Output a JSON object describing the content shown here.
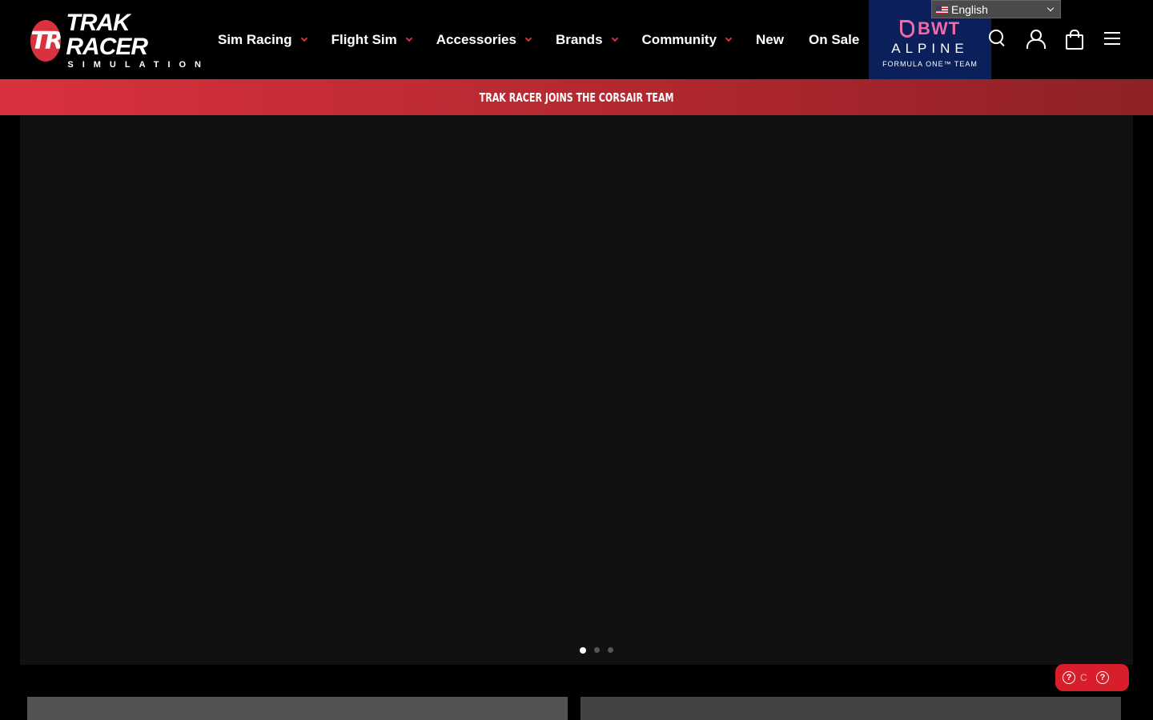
{
  "brand": {
    "badge": "TR",
    "name": "TRAK RACER",
    "tagline": "SIMULATION"
  },
  "nav": {
    "items": [
      {
        "label": "Sim Racing",
        "has_dropdown": true
      },
      {
        "label": "Flight Sim",
        "has_dropdown": true
      },
      {
        "label": "Accessories",
        "has_dropdown": true
      },
      {
        "label": "Brands",
        "has_dropdown": true
      },
      {
        "label": "Community",
        "has_dropdown": true
      },
      {
        "label": "New",
        "has_dropdown": false
      },
      {
        "label": "On Sale",
        "has_dropdown": false
      }
    ]
  },
  "sponsor": {
    "line1": "BWT",
    "line2": "ALPINE",
    "line3": "FORMULA ONE™ TEAM"
  },
  "language": {
    "selected": "English"
  },
  "header_icons": [
    "search-icon",
    "user-icon",
    "cart-icon",
    "menu-icon"
  ],
  "announcement": {
    "text": "TRAK RACER JOINS THE CORSAIR TEAM"
  },
  "slider": {
    "slide_count": 3,
    "active_index": 0
  },
  "help_widget": {
    "label": "C"
  },
  "colors": {
    "brand_red": "#d9323e",
    "sponsor_blue": "#0b1f5b",
    "sponsor_pink": "#f06aa8",
    "hero_bg": "#111111"
  }
}
